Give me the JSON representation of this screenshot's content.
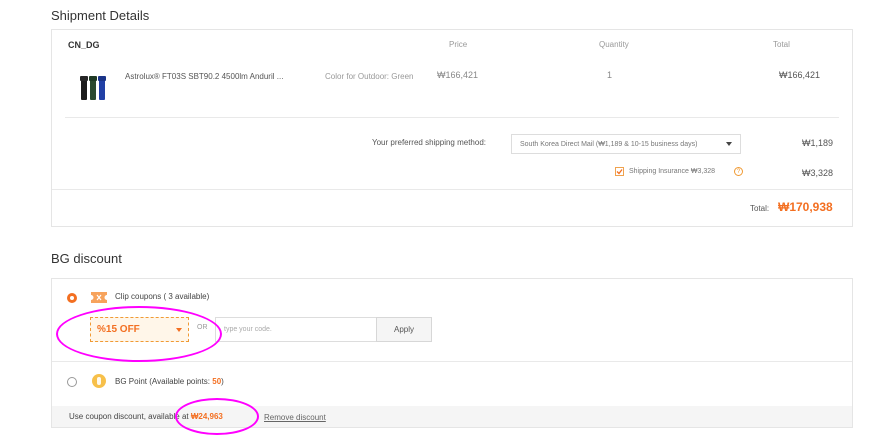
{
  "shipment": {
    "title": "Shipment Details",
    "warehouse": "CN_DG",
    "headers": {
      "price": "Price",
      "quantity": "Quantity",
      "total": "Total"
    },
    "item": {
      "name": "Astrolux® FT03S SBT90.2 4500lm Anduril ...",
      "variant": "Color for Outdoor: Green",
      "price": "₩166,421",
      "quantity": "1",
      "total": "₩166,421"
    },
    "shipping_label": "Your preferred shipping method:",
    "shipping_selected": "South Korea Direct Mail (₩1,189 & 10-15 business days)",
    "shipping_cost": "₩1,189",
    "insurance_label": "Shipping Insurance",
    "insurance_value": "₩3,328",
    "insurance_cost": "₩3,328",
    "total_label": "Total:",
    "total_value": "₩170,938"
  },
  "discount": {
    "title": "BG discount",
    "clip_label": "Clip coupons ( 3 available)",
    "coupon_selected": "%15 OFF",
    "or": "OR",
    "code_placeholder": "type your code.",
    "apply": "Apply",
    "points_label": "BG Point (Available points: ",
    "points_value": "50",
    "points_suffix": ")",
    "use_prefix": "Use coupon discount, available at ",
    "use_value": "₩24,963",
    "remove": "Remove discount"
  },
  "colors": {
    "accent": "#f36f21",
    "annotation": "#ff00ff"
  },
  "icons": {
    "coupon": "coupon-tag-icon",
    "point": "coin-icon",
    "insurance": "question-circle-icon",
    "check": "checkbox-checked-icon"
  }
}
